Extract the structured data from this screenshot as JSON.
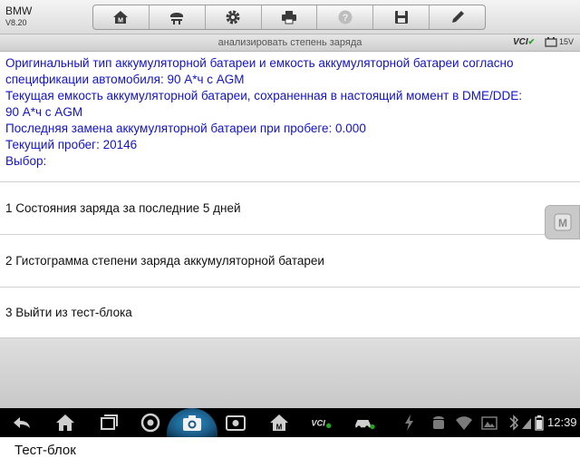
{
  "app": {
    "make": "BMW",
    "version": "V8.20"
  },
  "toolbar": {
    "buttons": [
      {
        "name": "home",
        "icon": "home-icon"
      },
      {
        "name": "vehicle",
        "icon": "car-lift-icon"
      },
      {
        "name": "settings",
        "icon": "gear-icon"
      },
      {
        "name": "print",
        "icon": "printer-icon"
      },
      {
        "name": "help",
        "icon": "help-icon"
      },
      {
        "name": "save",
        "icon": "save-icon"
      },
      {
        "name": "edit",
        "icon": "pen-icon"
      }
    ]
  },
  "titlebar": {
    "title": "анализировать степень заряда",
    "vci": "VCI",
    "battery": "15V"
  },
  "info": {
    "lines": [
      "Оригинальный тип аккумуляторной батареи и емкость аккумуляторной батареи согласно",
      "спецификации автомобиля:  90 А*ч с AGM",
      "Текущая емкость аккумуляторной батареи, сохраненная в настоящий момент в DME/DDE:",
      "90 А*ч с AGM",
      "Последняя замена аккумуляторной батареи при пробеге: 0.000",
      "Текущий пробег: 20146",
      "Выбор:"
    ]
  },
  "menu": {
    "items": [
      {
        "label": "1 Состояния заряда за последние 5 дней"
      },
      {
        "label": "2 Гистограмма степени заряда аккумуляторной батареи"
      },
      {
        "label": "3 Выйти из тест-блока"
      }
    ]
  },
  "navbar": {
    "vci": "VCI",
    "time": "12:39"
  },
  "footer": {
    "label": "Тест-блок"
  },
  "colors": {
    "info_text": "#1313c8",
    "accent": "#2b8fc8",
    "vci_ok": "#22a322"
  }
}
